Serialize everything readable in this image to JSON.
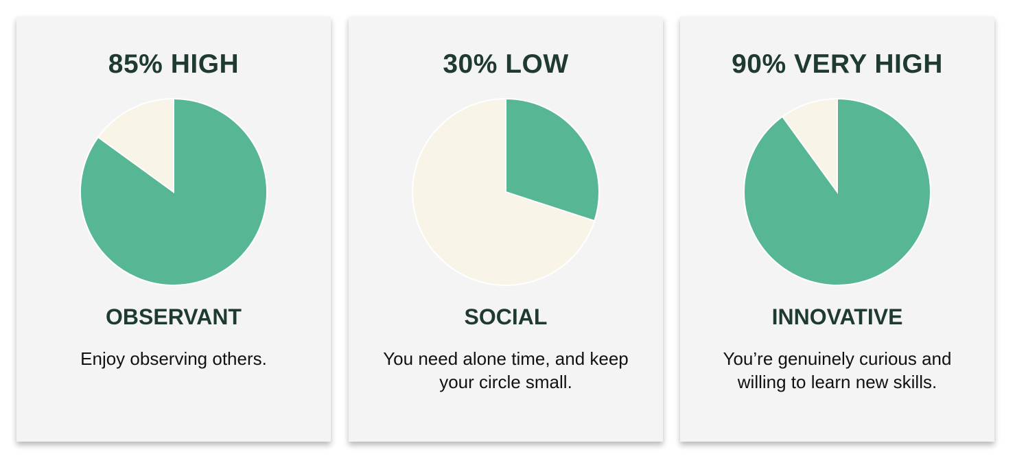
{
  "colors": {
    "filled": "#57b794",
    "remainder": "#f8f4e8",
    "card_bg": "#f4f4f4",
    "heading": "#1f3b30"
  },
  "cards": [
    {
      "score_label": "85% HIGH",
      "percent": 85,
      "trait": "OBSERVANT",
      "description": "Enjoy observing others."
    },
    {
      "score_label": "30% LOW",
      "percent": 30,
      "trait": "SOCIAL",
      "description": "You need alone time, and keep your circle small."
    },
    {
      "score_label": "90% VERY HIGH",
      "percent": 90,
      "trait": "INNOVATIVE",
      "description": "You’re genuinely curious and willing to learn new skills."
    }
  ]
}
